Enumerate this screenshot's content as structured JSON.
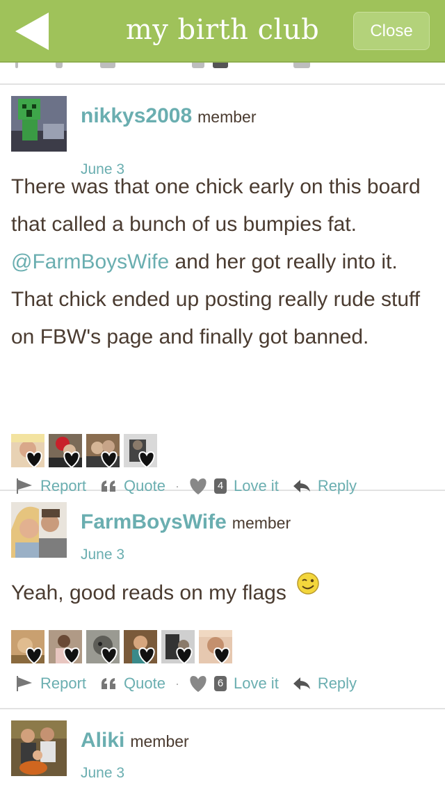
{
  "header": {
    "title": "my birth club",
    "close_label": "Close"
  },
  "posts": [
    {
      "username": "nikkys2008",
      "role": "member",
      "date": "June 3",
      "text_before": "There was that one chick early on this board that called a bunch of us bumpies fat. ",
      "mention": "@FarmBoysWife",
      "text_after": " and her got really into it. That chick ended up posting really rude stuff on FBW's page and finally got banned.",
      "actions": {
        "report": "Report",
        "quote": "Quote",
        "love_count": "4",
        "love": "Love it",
        "reply": "Reply"
      }
    },
    {
      "username": "FarmBoysWife",
      "role": "member",
      "date": "June 3",
      "text": "Yeah, good reads on my flags",
      "actions": {
        "report": "Report",
        "quote": "Quote",
        "love_count": "6",
        "love": "Love it",
        "reply": "Reply"
      }
    },
    {
      "username": "Aliki",
      "role": "member",
      "date": "June 3"
    }
  ],
  "icons": {
    "back": "back-arrow-icon",
    "report": "flag-icon",
    "quote": "quote-icon",
    "love": "heart-icon",
    "reply": "reply-arrow-icon",
    "emoji": "wink-emoji-icon"
  },
  "colors": {
    "header_bg": "#9fc25a",
    "link": "#6aaeb0",
    "text": "#4a3b30"
  }
}
